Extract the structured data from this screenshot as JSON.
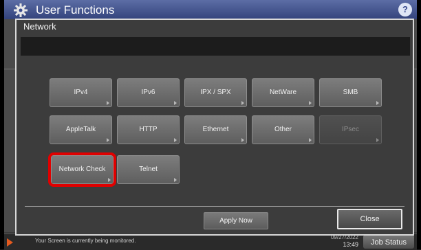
{
  "app": {
    "title": "User Functions",
    "gear_icon": "gear-icon",
    "help_label": "?"
  },
  "dialog": {
    "title": "Network",
    "buttons": [
      {
        "label": "IPv4",
        "enabled": true
      },
      {
        "label": "IPv6",
        "enabled": true
      },
      {
        "label": "IPX / SPX",
        "enabled": true
      },
      {
        "label": "NetWare",
        "enabled": true
      },
      {
        "label": "SMB",
        "enabled": true
      },
      {
        "label": "AppleTalk",
        "enabled": true
      },
      {
        "label": "HTTP",
        "enabled": true
      },
      {
        "label": "Ethernet",
        "enabled": true
      },
      {
        "label": "Other",
        "enabled": true
      },
      {
        "label": "IPsec",
        "enabled": false
      },
      {
        "label": "Network Check",
        "enabled": true,
        "highlighted": true
      },
      {
        "label": "Telnet",
        "enabled": true
      }
    ],
    "apply_label": "Apply Now",
    "close_label": "Close"
  },
  "statusbar": {
    "message": "Your Screen is currently being monitored.",
    "date": "09/27/2022",
    "time": "13:49",
    "job_status_label": "Job Status"
  },
  "colors": {
    "accent_title": "#4a5a9a",
    "highlight": "#e00000",
    "status_arrow": "#e45a1f"
  }
}
